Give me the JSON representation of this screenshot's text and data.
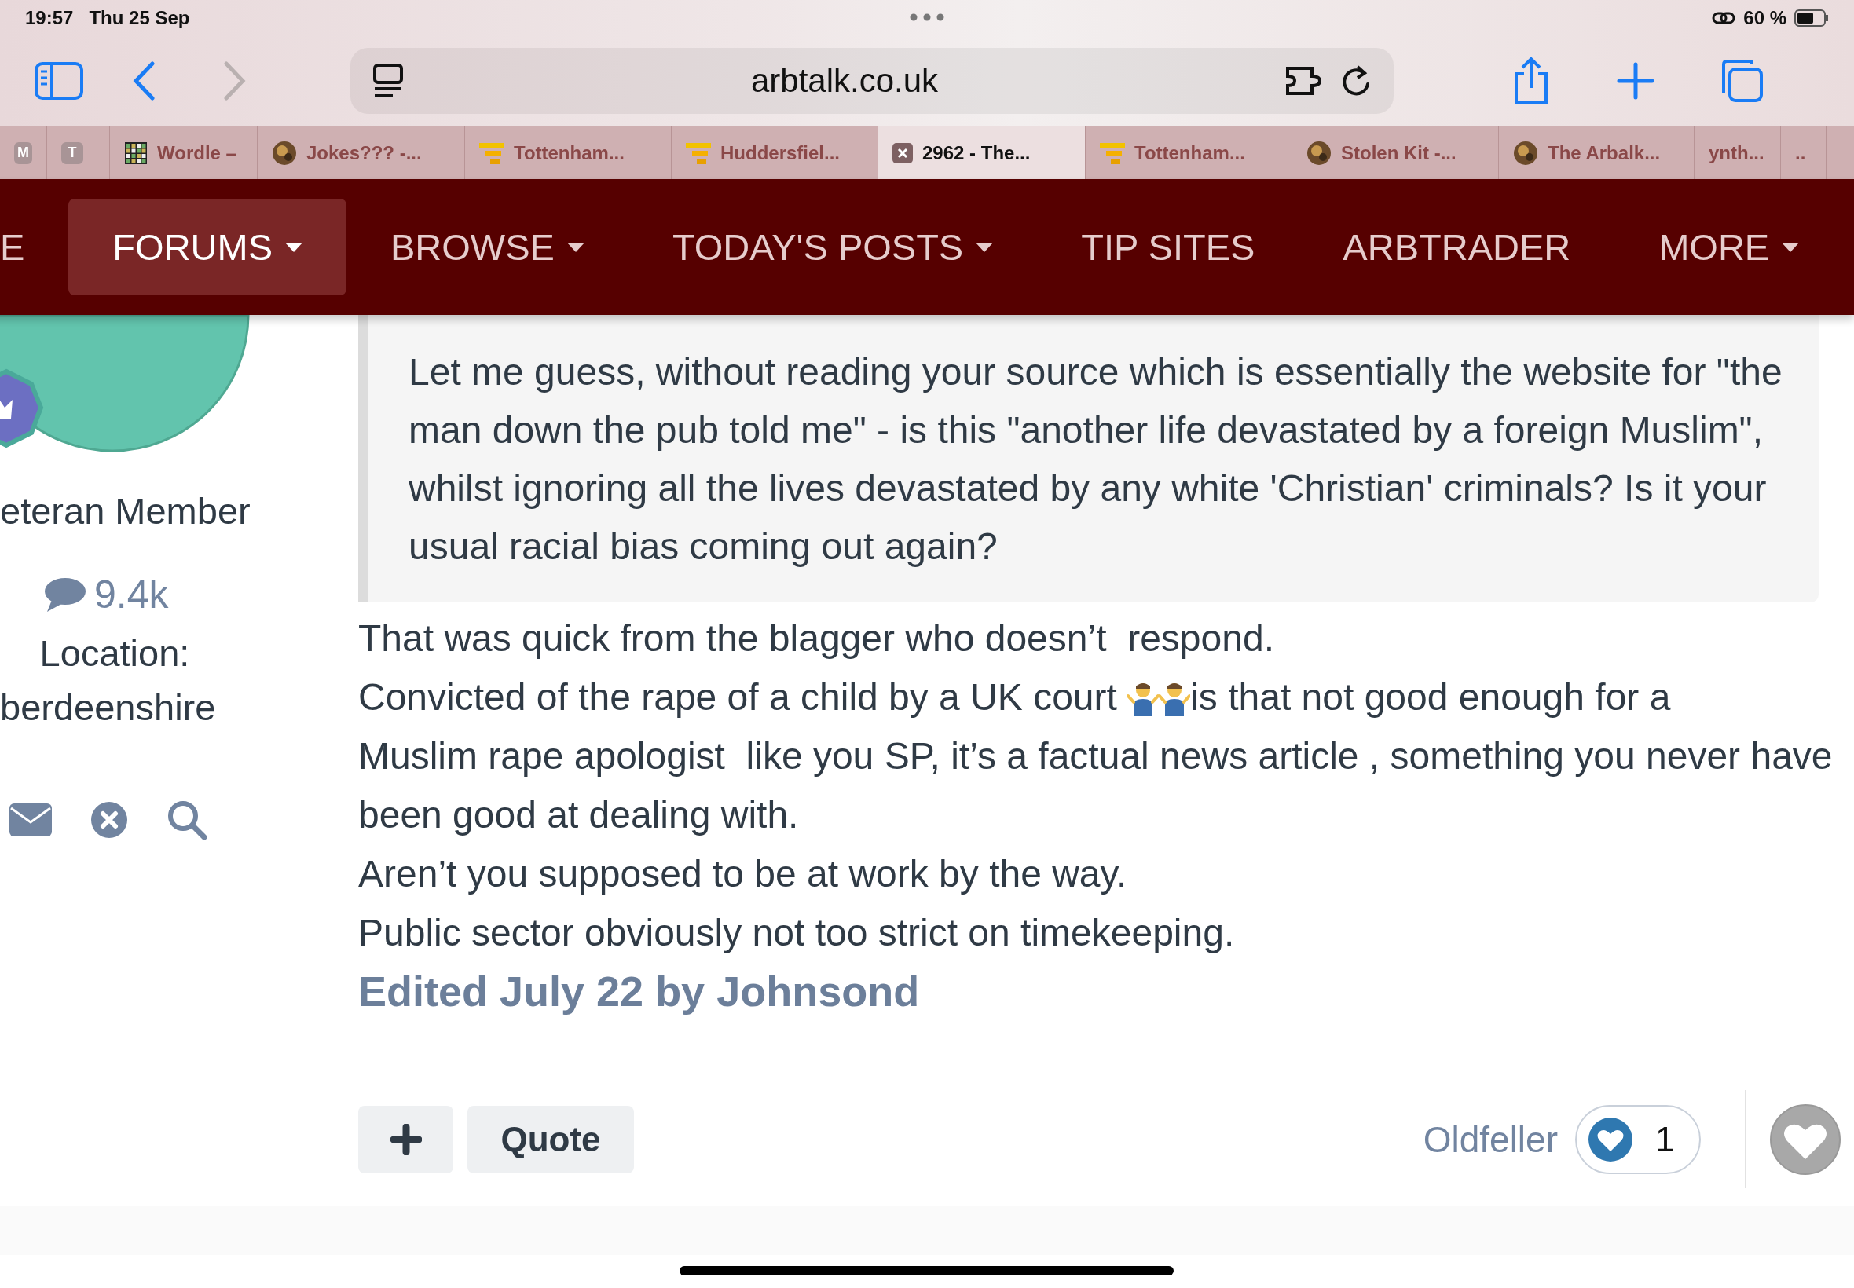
{
  "status_bar": {
    "time": "19:57",
    "date": "Thu 25 Sep",
    "battery": "60 %"
  },
  "toolbar": {
    "url": "arbtalk.co.uk",
    "forward_disabled": true
  },
  "tabs": [
    {
      "kind": "letter",
      "letter": "M",
      "selected": false
    },
    {
      "kind": "letter",
      "letter": "T",
      "selected": false
    },
    {
      "label": "Wordle –",
      "kind": "grid",
      "selected": false
    },
    {
      "label": "Jokes??? -...",
      "kind": "avatar",
      "selected": false
    },
    {
      "label": "Tottenham...",
      "kind": "stack",
      "selected": false
    },
    {
      "label": "Huddersfiel...",
      "kind": "stack",
      "selected": false
    },
    {
      "label": "2962 - The...",
      "kind": "close",
      "selected": true
    },
    {
      "label": "Tottenham...",
      "kind": "stack",
      "selected": false
    },
    {
      "label": "Stolen Kit -...",
      "kind": "avatar",
      "selected": false
    },
    {
      "label": "The Arbalk...",
      "kind": "avatar",
      "selected": false
    },
    {
      "label": "ynth...",
      "kind": "none",
      "selected": false
    },
    {
      "label": "..",
      "kind": "none",
      "selected": false
    }
  ],
  "nav": [
    {
      "label": "E",
      "dropdown": false,
      "selected": false
    },
    {
      "label": "FORUMS",
      "dropdown": true,
      "selected": true
    },
    {
      "label": "BROWSE",
      "dropdown": true,
      "selected": false
    },
    {
      "label": "TODAY'S POSTS",
      "dropdown": true,
      "selected": false
    },
    {
      "label": "TIP SITES",
      "dropdown": false,
      "selected": false
    },
    {
      "label": "ARBTRADER",
      "dropdown": false,
      "selected": false
    },
    {
      "label": "MORE",
      "dropdown": true,
      "selected": false
    }
  ],
  "profile": {
    "rank": "eteran Member",
    "post_count": "9.4k",
    "location_label": "Location:",
    "location": "berdeenshire"
  },
  "quote": "Let me guess, without reading your source which is essentially the website for \"the man down the pub told me\" - is this \"another life devastated by a foreign Muslim\", whilst ignoring all the lives devastated by any white 'Christian' criminals? Is it your usual racial bias coming out again?",
  "post": [
    [
      {
        "kind": "text",
        "text": "That was quick from the blagger who doesn’t  respond."
      }
    ],
    [
      {
        "kind": "text",
        "text": "Convicted of the rape of a child by a UK court "
      },
      {
        "kind": "shrug"
      },
      {
        "kind": "shrug"
      },
      {
        "kind": "text",
        "text": "is that not good enough for a"
      },
      {
        "kind": "line",
        "text": "Muslim rape apologist  like you SP, it’s a factual news article , something you never have been good at dealing with."
      }
    ],
    [
      {
        "kind": "text",
        "text": "Aren’t you supposed to be at work by the way."
      }
    ],
    [
      {
        "kind": "text",
        "text": "Public sector obviously not too strict on timekeeping."
      }
    ]
  ],
  "edited": "Edited July 22 by Johnsond",
  "actions": {
    "quote": "Quote"
  },
  "reactions": {
    "user": "Oldfeller",
    "count": "1"
  }
}
